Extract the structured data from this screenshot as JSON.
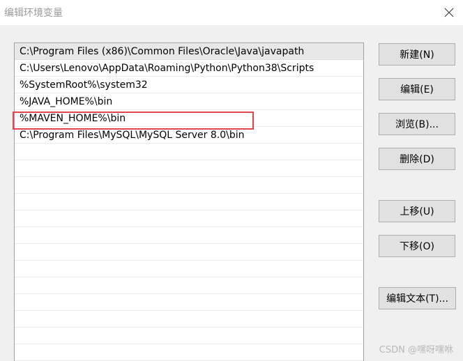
{
  "window": {
    "title": "编辑环境变量"
  },
  "paths": [
    "C:\\Program Files (x86)\\Common Files\\Oracle\\Java\\javapath",
    "C:\\Users\\Lenovo\\AppData\\Roaming\\Python\\Python38\\Scripts",
    "%SystemRoot%\\system32",
    "%JAVA_HOME%\\bin",
    "%MAVEN_HOME%\\bin",
    "C:\\Program Files\\MySQL\\MySQL Server 8.0\\bin"
  ],
  "selected_index": 0,
  "highlighted_index": 4,
  "buttons": {
    "new": "新建(N)",
    "edit": "编辑(E)",
    "browse": "浏览(B)...",
    "delete": "删除(D)",
    "move_up": "上移(U)",
    "move_down": "下移(O)",
    "edit_text": "编辑文本(T)..."
  },
  "watermark": "CSDN @嘿呀嘿咻",
  "colors": {
    "highlight_border": "#e0454b",
    "selected_row": "#e8e8e8"
  },
  "icons": {
    "close": "close-icon"
  }
}
